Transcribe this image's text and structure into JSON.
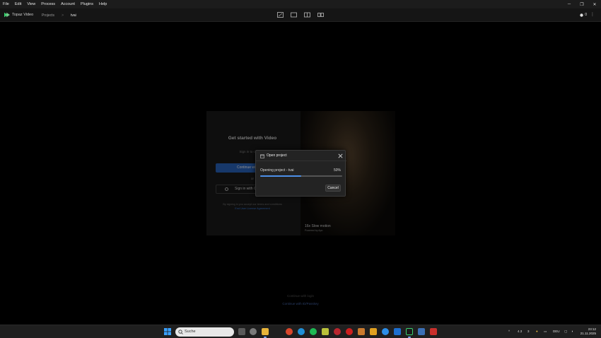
{
  "menubar": {
    "items": [
      "File",
      "Edit",
      "View",
      "Process",
      "Account",
      "Plugins",
      "Help"
    ]
  },
  "window_controls": {
    "minimize": "─",
    "maximize": "❐",
    "close": "✕"
  },
  "appbar": {
    "brand": "Topaz Video",
    "breadcrumb": {
      "root": "Projects",
      "separator": ">",
      "current": "tvai"
    },
    "credits": "0"
  },
  "welcome": {
    "title": "Get started with Video",
    "subtitle": "Sign in to continue",
    "continue_label": "Continue with email",
    "or_label": "or",
    "signin_label": "Sign in with Google",
    "terms_line1": "By signing in you accept our terms and conditions",
    "terms_line2": "End User License Agreement",
    "promo_title": "16x Slow motion",
    "promo_sub": "Powered by Apo"
  },
  "footer": {
    "line1": "Continue with login",
    "line2": "Continue with ID/Passkey"
  },
  "modal": {
    "title": "Open project",
    "progress_label": "Opening project - tvai",
    "progress_percent": 50,
    "progress_text": "50%",
    "cancel_label": "Cancel"
  },
  "taskbar": {
    "search_placeholder": "Suche",
    "tray": {
      "temp": "4.3",
      "num": "3",
      "lang": "DEU"
    },
    "clock": {
      "time": "23:12",
      "date": "21.11.2025"
    }
  },
  "colors": {
    "accent": "#4d8fe8",
    "brand_green": "#3bd16f",
    "continue_blue": "#2a66c2"
  }
}
